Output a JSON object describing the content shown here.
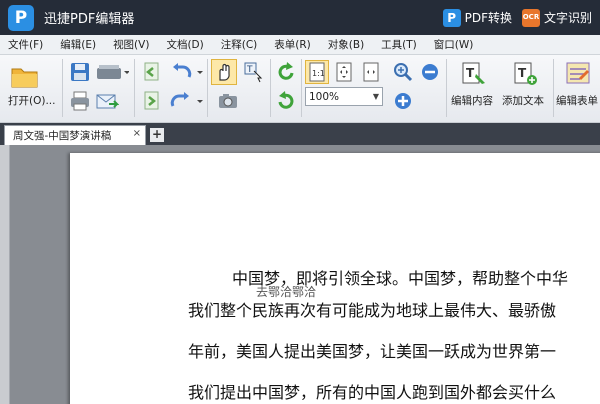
{
  "app": {
    "title": "迅捷PDF编辑器",
    "logo_letter": "P",
    "pdf_convert_label": "PDF转换",
    "pdf_badge_letter": "P",
    "ocr_badge": "OCR",
    "ocr_label": "文字识别"
  },
  "menu": [
    "文件(F)",
    "编辑(E)",
    "视图(V)",
    "文档(D)",
    "注释(C)",
    "表单(R)",
    "对象(B)",
    "工具(T)",
    "窗口(W)"
  ],
  "toolbar": {
    "open_label": "打开(O)...",
    "zoom_value": "100%",
    "edit_content_label": "编辑内容",
    "add_text_label": "添加文本",
    "edit_form_label": "编辑表单"
  },
  "tabs": {
    "active_doc": "周文强-中国梦演讲稿",
    "close_glyph": "×",
    "new_tab_glyph": "+"
  },
  "document": {
    "lines": [
      "中国梦，即将引领全球。中国梦，帮助整个中华",
      "我们整个民族再次有可能成为地球上最伟大、最骄傲",
      "年前，美国人提出美国梦，让美国一跃成为世界第一",
      "我们提出中国梦，所有的中国人跑到国外都会买什么"
    ],
    "annotation": "去鄂洽鄂洽"
  },
  "colors": {
    "titlebar": "#252c38",
    "accent_blue": "#2b8fe3",
    "ocr_orange": "#e8762c"
  }
}
